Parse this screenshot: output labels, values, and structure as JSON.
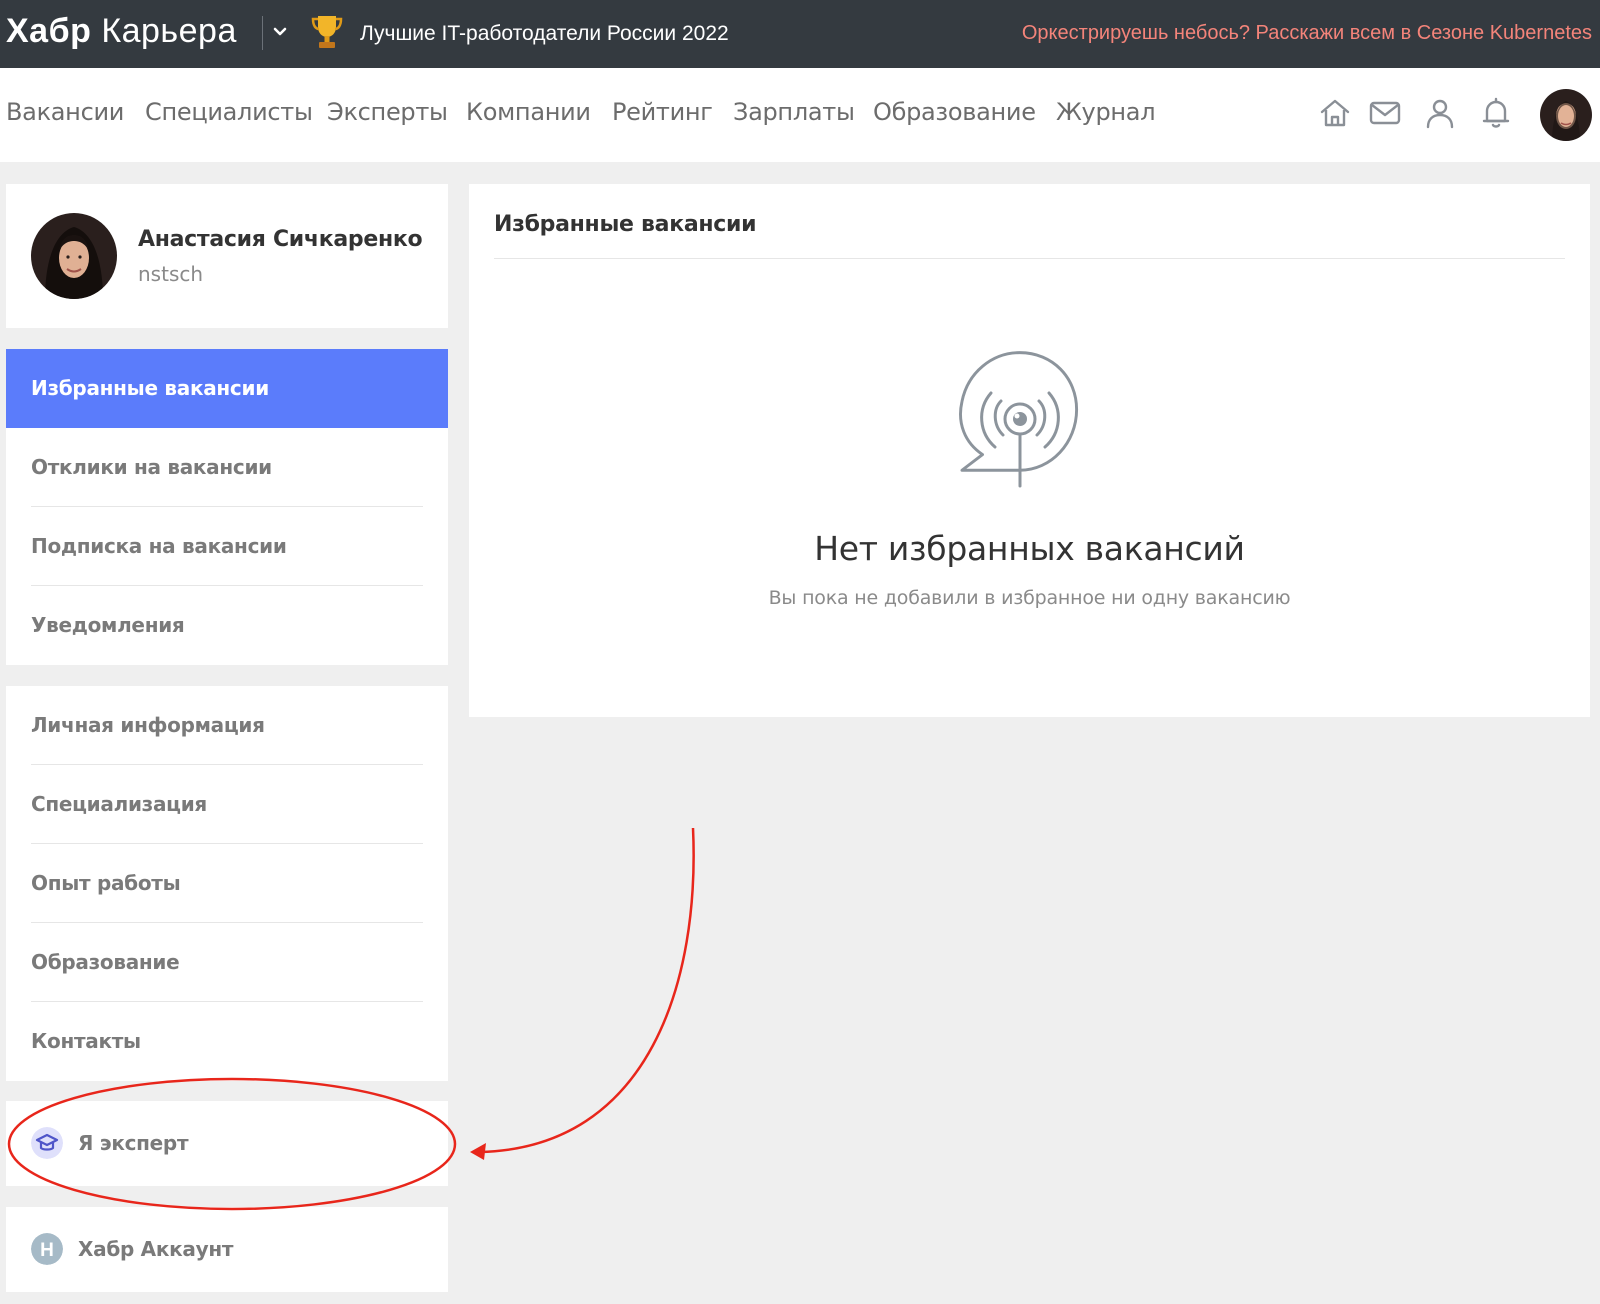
{
  "topbar": {
    "logo_bold": "Хабр",
    "logo_light": "Карьера",
    "logo_chevron_icon": "chevron-down-icon",
    "trophy_icon": "trophy-icon",
    "promo_left": "Лучшие IT-работодатели России 2022",
    "promo_right": "Оркестрируешь небось? Расскажи всем в Сезоне Kubernetes",
    "promo_right_color": "#f4847a"
  },
  "nav": {
    "items": [
      "Вакансии",
      "Специалисты",
      "Эксперты",
      "Компании",
      "Рейтинг",
      "Зарплаты",
      "Образование",
      "Журнал"
    ],
    "icons": [
      "home-icon",
      "mail-icon",
      "user-icon",
      "bell-icon"
    ]
  },
  "profile": {
    "name": "Анастасия Сичкаренко",
    "login": "nstsch"
  },
  "sidebar": {
    "vacancy_menu": [
      "Избранные вакансии",
      "Отклики на вакансии",
      "Подписка на вакансии",
      "Уведомления"
    ],
    "active_index": 0,
    "active_color": "#5b7cfb",
    "profile_menu": [
      "Личная информация",
      "Специализация",
      "Опыт работы",
      "Образование",
      "Контакты"
    ],
    "expert": {
      "label": "Я эксперт",
      "icon": "graduation-cap-icon"
    },
    "habr_account": {
      "label": "Хабр Аккаунт",
      "icon": "habr-h-icon",
      "letter": "H"
    }
  },
  "main": {
    "title": "Избранные вакансии",
    "empty_icon": "broadcast-eye-icon",
    "empty_title": "Нет избранных вакансий",
    "empty_subtitle": "Вы пока не добавили в избранное ни одну вакансию"
  },
  "annotation": {
    "color": "#e8261b",
    "target": "Я эксперт"
  }
}
